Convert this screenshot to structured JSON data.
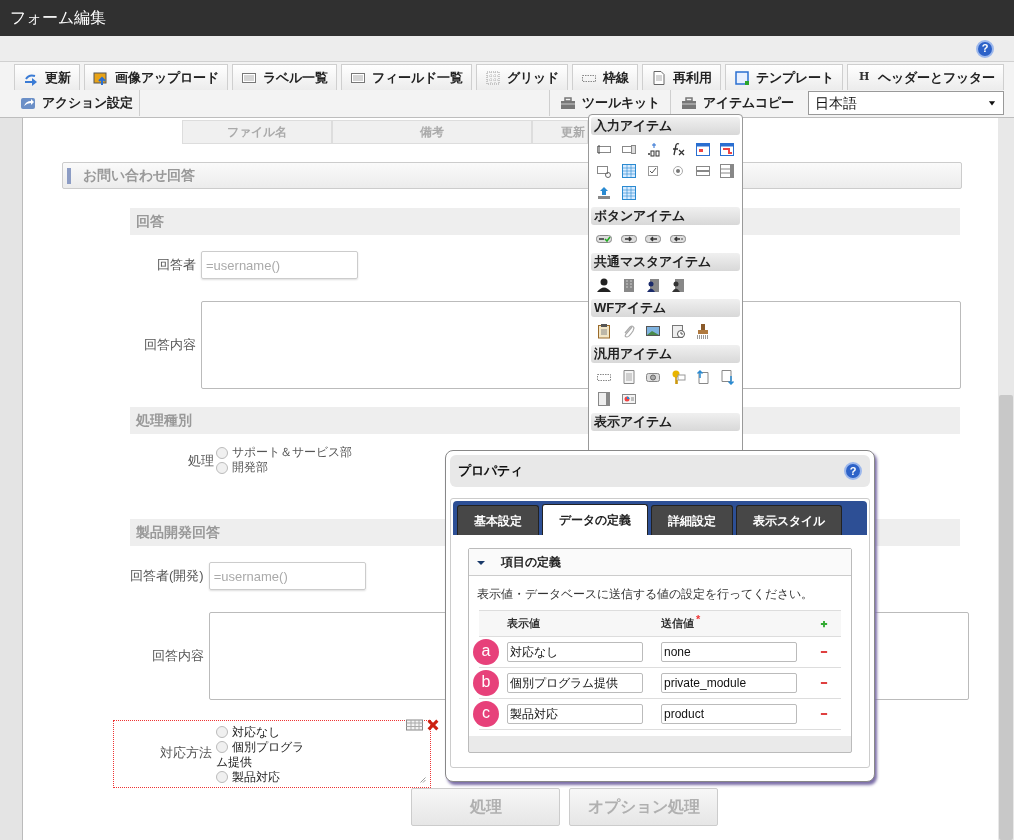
{
  "window": {
    "title": "フォーム編集"
  },
  "top_bar": {
    "help_glyph": "?"
  },
  "toolbar": {
    "row_1": [
      {
        "label": "更新"
      },
      {
        "label": "画像アップロード"
      },
      {
        "label": "ラベル一覧"
      },
      {
        "label": "フィールド一覧"
      },
      {
        "label": "グリッド"
      },
      {
        "label": "枠線"
      },
      {
        "label": "再利用"
      },
      {
        "label": "テンプレート"
      },
      {
        "label": "ヘッダーとフッター",
        "glyph": "H"
      }
    ],
    "row_2_left": [
      {
        "label": "アクション設定"
      }
    ],
    "row_2_right": [
      {
        "label": "ツールキット"
      },
      {
        "label": "アイテムコピー"
      }
    ],
    "language": {
      "value": "日本語"
    }
  },
  "file_table": {
    "columns": [
      "ファイル名",
      "備考",
      "更新"
    ]
  },
  "form": {
    "section_title": "お問い合わせ回答",
    "groups": [
      {
        "title": "回答",
        "fields": [
          {
            "kind": "text",
            "label": "回答者",
            "placeholder": "=username()"
          },
          {
            "kind": "textarea",
            "label": "回答内容"
          }
        ]
      },
      {
        "title": "処理種別",
        "fields": [
          {
            "kind": "radio",
            "label": "処理",
            "editing": false,
            "options": [
              {
                "label": "サポート＆サービス部",
                "selected": false
              },
              {
                "label": "開発部",
                "selected": false
              }
            ]
          }
        ]
      },
      {
        "title": "製品開発回答",
        "fields": [
          {
            "kind": "text",
            "label": "回答者(開発)",
            "placeholder": "=username()"
          },
          {
            "kind": "textarea",
            "label": "回答内容"
          },
          {
            "kind": "radio",
            "label": "対応方法",
            "editing": true,
            "options": [
              {
                "label": "対応なし",
                "selected": false
              },
              {
                "label": "個別プログラム提供",
                "selected": false
              },
              {
                "label": "製品対応",
                "selected": false
              }
            ]
          }
        ]
      }
    ]
  },
  "form_buttons": [
    {
      "label": "処理",
      "disabled": true
    },
    {
      "label": "オプション処理",
      "disabled": true
    }
  ],
  "palette": {
    "sections": [
      {
        "title": "入力アイテム"
      },
      {
        "title": "ボタンアイテム"
      },
      {
        "title": "共通マスタアイテム"
      },
      {
        "title": "WFアイテム"
      },
      {
        "title": "汎用アイテム"
      },
      {
        "title": "表示アイテム"
      }
    ]
  },
  "properties": {
    "title": "プロパティ",
    "help_glyph": "?",
    "tabs": [
      {
        "label": "基本設定",
        "selected": false
      },
      {
        "label": "データの定義",
        "selected": true
      },
      {
        "label": "詳細設定",
        "selected": false
      },
      {
        "label": "表示スタイル",
        "selected": false
      }
    ],
    "panel": {
      "title": "項目の定義",
      "expanded": true,
      "description": "表示値・データベースに送信する値の設定を行ってください。",
      "columns": [
        {
          "label": "表示値"
        },
        {
          "label": "送信値",
          "mark": "*"
        }
      ],
      "rows": [
        {
          "badge": "a",
          "display": "対応なし",
          "value": "none"
        },
        {
          "badge": "b",
          "display": "個別プログラム提供",
          "value": "private_module"
        },
        {
          "badge": "c",
          "display": "製品対応",
          "value": "product"
        }
      ]
    }
  }
}
